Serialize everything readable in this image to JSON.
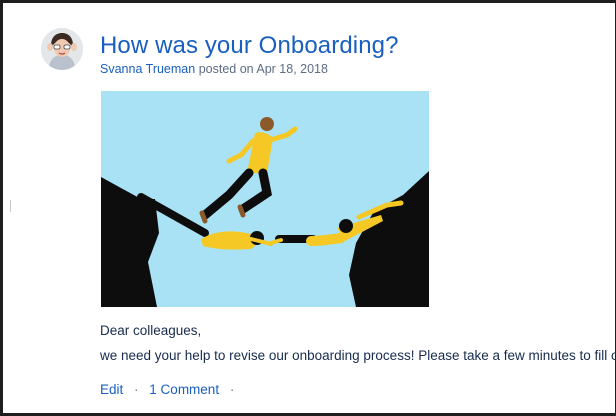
{
  "post": {
    "title": "How was your Onboarding?",
    "author": "Svanna Trueman",
    "posted_text": "posted on Apr 18, 2018",
    "body": [
      "Dear colleagues,",
      "we need your help to revise our onboarding process! Please take a few minutes to fill out ou"
    ]
  },
  "actions": {
    "edit_label": "Edit",
    "separator": "·",
    "comments_label": "1 Comment",
    "trailing_separator": "·"
  },
  "colors": {
    "link": "#1a5fbf",
    "sky": "#a9e2f5",
    "shirt": "#f5c826",
    "cliff": "#0d0d0d"
  },
  "icons": {
    "avatar": "user-avatar-icon",
    "hero": "onboarding-illustration-icon"
  }
}
